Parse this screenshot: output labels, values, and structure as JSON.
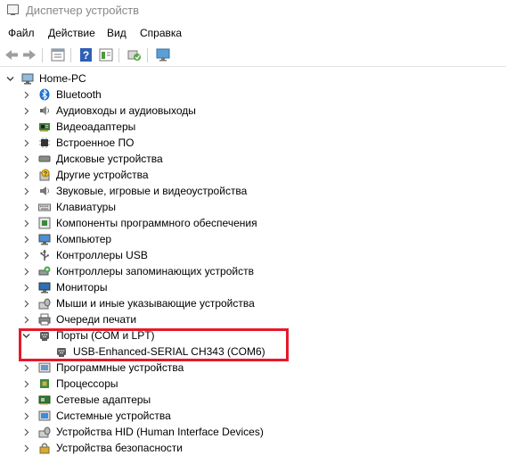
{
  "window": {
    "title": "Диспетчер устройств"
  },
  "menu": {
    "items": [
      "Файл",
      "Действие",
      "Вид",
      "Справка"
    ]
  },
  "tree": {
    "root": "Home-PC",
    "categories": [
      {
        "label": "Bluetooth",
        "icon": "bluetooth-icon",
        "expanded": false
      },
      {
        "label": "Аудиовходы и аудиовыходы",
        "icon": "speaker-icon",
        "expanded": false
      },
      {
        "label": "Видеоадаптеры",
        "icon": "display-adapter-icon",
        "expanded": false
      },
      {
        "label": "Встроенное ПО",
        "icon": "firmware-icon",
        "expanded": false
      },
      {
        "label": "Дисковые устройства",
        "icon": "disk-drive-icon",
        "expanded": false
      },
      {
        "label": "Другие устройства",
        "icon": "unknown-device-icon",
        "expanded": false
      },
      {
        "label": "Звуковые, игровые и видеоустройства",
        "icon": "sound-icon",
        "expanded": false
      },
      {
        "label": "Клавиатуры",
        "icon": "keyboard-icon",
        "expanded": false
      },
      {
        "label": "Компоненты программного обеспечения",
        "icon": "software-component-icon",
        "expanded": false
      },
      {
        "label": "Компьютер",
        "icon": "computer-icon",
        "expanded": false
      },
      {
        "label": "Контроллеры USB",
        "icon": "usb-icon",
        "expanded": false
      },
      {
        "label": "Контроллеры запоминающих устройств",
        "icon": "storage-controller-icon",
        "expanded": false
      },
      {
        "label": "Мониторы",
        "icon": "monitor-icon",
        "expanded": false
      },
      {
        "label": "Мыши и иные указывающие устройства",
        "icon": "mouse-icon",
        "expanded": false
      },
      {
        "label": "Очереди печати",
        "icon": "printer-icon",
        "expanded": false
      },
      {
        "label": "Порты (COM и LPT)",
        "icon": "port-icon",
        "expanded": true,
        "children": [
          {
            "label": "USB-Enhanced-SERIAL CH343 (COM6)",
            "icon": "port-icon"
          }
        ]
      },
      {
        "label": "Программные устройства",
        "icon": "software-device-icon",
        "expanded": false
      },
      {
        "label": "Процессоры",
        "icon": "processor-icon",
        "expanded": false
      },
      {
        "label": "Сетевые адаптеры",
        "icon": "network-adapter-icon",
        "expanded": false
      },
      {
        "label": "Системные устройства",
        "icon": "system-device-icon",
        "expanded": false
      },
      {
        "label": "Устройства HID (Human Interface Devices)",
        "icon": "hid-icon",
        "expanded": false
      },
      {
        "label": "Устройства безопасности",
        "icon": "security-device-icon",
        "expanded": false
      }
    ]
  },
  "colors": {
    "highlight": "#e8182a",
    "title_text": "#888888"
  }
}
